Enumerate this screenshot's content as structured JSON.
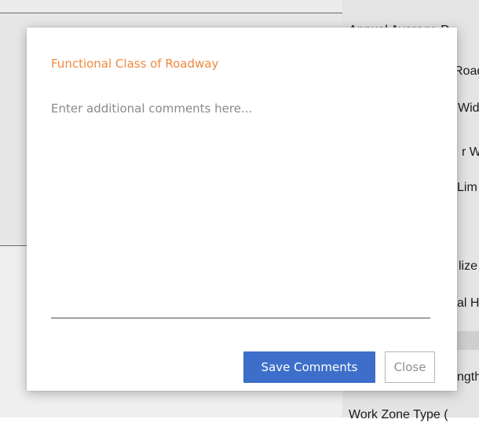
{
  "background": {
    "right_column_labels": [
      "Annual Average D",
      "Roadw",
      "Wid",
      "r W",
      "Lim",
      "lize",
      "al H",
      "ngth",
      "Work Zone Type ("
    ]
  },
  "modal": {
    "title": "Functional Class of Roadway",
    "comments_placeholder": "Enter additional comments here...",
    "comments_value": "",
    "save_label": "Save Comments",
    "close_label": "Close",
    "colors": {
      "title": "#f0883e",
      "save_button": "#3d6fca"
    }
  }
}
